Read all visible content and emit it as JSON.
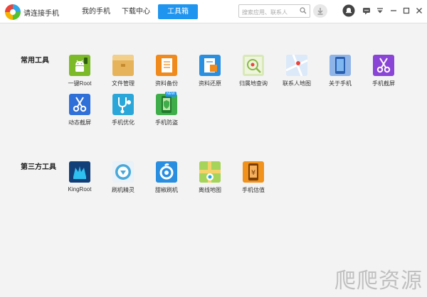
{
  "header": {
    "app_title": "请连接手机",
    "tabs": [
      {
        "label": "我的手机"
      },
      {
        "label": "下载中心"
      },
      {
        "label": "工具箱"
      }
    ],
    "active_tab": "工具箱",
    "search_placeholder": "搜索应用、联系人"
  },
  "sections": {
    "common": {
      "title": "常用工具",
      "items": [
        {
          "label": "一键Root",
          "icon": "android-root-icon",
          "color": "#7cba2a"
        },
        {
          "label": "文件管理",
          "icon": "folder-icon",
          "color": "#e6b35a"
        },
        {
          "label": "资料备份",
          "icon": "backup-document-icon",
          "color": "#f08a1c"
        },
        {
          "label": "资料还原",
          "icon": "restore-document-icon",
          "color": "#2b8fe0"
        },
        {
          "label": "归属地查询",
          "icon": "location-query-icon",
          "color": "#a7d26b"
        },
        {
          "label": "联系人地图",
          "icon": "contact-map-icon",
          "color": "#7fb4ea"
        },
        {
          "label": "关于手机",
          "icon": "phone-info-icon",
          "color": "#4a8fe0"
        },
        {
          "label": "手机截屏",
          "icon": "scissors-icon",
          "color": "#8b45d6"
        },
        {
          "label": "动态截屏",
          "icon": "scissors-icon",
          "color": "#2f6fd8"
        },
        {
          "label": "手机优化",
          "icon": "stethoscope-icon",
          "color": "#2aa7d8"
        },
        {
          "label": "手机防盗",
          "icon": "anti-theft-icon",
          "color": "#3fae4a",
          "badge": "NEW"
        }
      ]
    },
    "third_party": {
      "title": "第三方工具",
      "items": [
        {
          "label": "KingRoot",
          "icon": "kingroot-icon",
          "color": "#1a5fa8"
        },
        {
          "label": "刷机精灵",
          "icon": "flash-sprite-icon",
          "color": "#4aa8d8"
        },
        {
          "label": "甜椒刷机",
          "icon": "pepper-flash-icon",
          "color": "#2a8ee0"
        },
        {
          "label": "离线地图",
          "icon": "offline-map-icon",
          "color": "#8dc63f"
        },
        {
          "label": "手机估值",
          "icon": "phone-valuation-icon",
          "color": "#f0921c"
        }
      ]
    }
  },
  "watermark": "爬爬资源"
}
